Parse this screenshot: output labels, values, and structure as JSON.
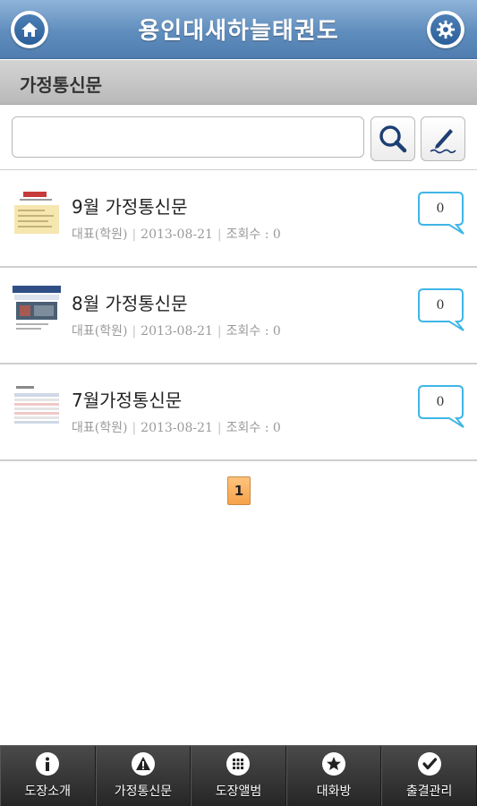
{
  "header": {
    "title": "용인대새하늘태권도",
    "home_icon": "home-icon",
    "settings_icon": "gear-icon"
  },
  "section": {
    "title": "가정통신문"
  },
  "search": {
    "value": "",
    "placeholder": "",
    "search_icon": "magnifier-icon",
    "write_icon": "pen-icon"
  },
  "posts": [
    {
      "title": "9월 가정통신문",
      "author": "대표(학원)",
      "date": "2013-08-21",
      "views": "조회수 : 0",
      "comments": "0"
    },
    {
      "title": "8월 가정통신문",
      "author": "대표(학원)",
      "date": "2013-08-21",
      "views": "조회수 : 0",
      "comments": "0"
    },
    {
      "title": "7월가정통신문",
      "author": "대표(학원)",
      "date": "2013-08-21",
      "views": "조회수 : 0",
      "comments": "0"
    }
  ],
  "pagination": {
    "current": "1"
  },
  "bottom_nav": [
    {
      "label": "도장소개",
      "icon": "info-icon"
    },
    {
      "label": "가정통신문",
      "icon": "warning-icon"
    },
    {
      "label": "도장앨범",
      "icon": "grid-icon"
    },
    {
      "label": "대화방",
      "icon": "star-icon"
    },
    {
      "label": "출결관리",
      "icon": "check-icon"
    }
  ],
  "colors": {
    "header": "#5f8dbd",
    "accent_bubble": "#3fb6e6",
    "page_active": "#f5a24a",
    "nav_bg": "#333333"
  }
}
